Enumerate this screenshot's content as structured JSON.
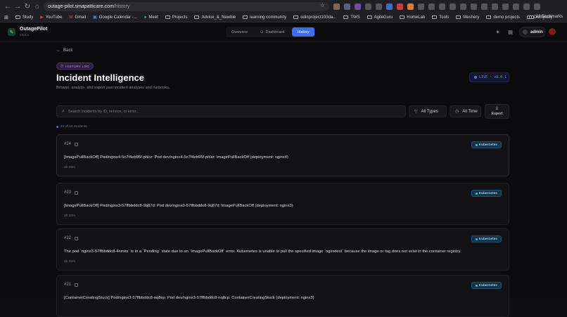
{
  "browser": {
    "url_host": "outage-pilot.smapatticare.com",
    "url_path": "/history",
    "bookmarks": [
      "Study",
      "YouTube",
      "Gmail",
      "Google Calendar -...",
      "Meet",
      "Projects",
      "Advice_&_Newbie",
      "learning community",
      "odinproject100da...",
      "TWS",
      "AgileGuru",
      "HomeLab",
      "Tools",
      "Meshery",
      "demo projects",
      "Demystify"
    ],
    "all_bookmarks": "All Bookmarks"
  },
  "app": {
    "brand": "OutagePilot",
    "version": "v.8.0.1",
    "tabs": [
      {
        "label": "Overview",
        "active": false
      },
      {
        "label": "Dashboard",
        "active": false
      },
      {
        "label": "History",
        "active": true
      }
    ],
    "user": "admin"
  },
  "page": {
    "back": "Back",
    "badge": "HISTORY LOG",
    "title": "Incident Intelligence",
    "subtitle": "Browse, analyze, and export past incident analyses and runbooks.",
    "live": "LIVE · v8.0.1",
    "search_placeholder": "Search incidents by ID, service, or error...",
    "filter_type": "All Types",
    "filter_time": "All Time",
    "export": "Export",
    "count": "24 of 24 incidents"
  },
  "incidents": [
    {
      "id": "#24",
      "tag": "Kubernetes",
      "text": "[ImagePullBackOff] Pod/nginx4-5c7f4eb95f-phlrz: Pod dev/nginx4-5c7f4eb95f-phlrz: ImagePullBackOff (deployment: nginx4)",
      "time": "1h 29m"
    },
    {
      "id": "#23",
      "tag": "Kubernetes",
      "text": "[ImagePullBackOff] Pod/nginx3-57ffbbddc8-9q87d: Pod dev/nginx3-57ffbbddc8-9q87d: ImagePullBackOff (deployment: nginx3)",
      "time": "1h 30m"
    },
    {
      "id": "#22",
      "tag": "Kubernetes",
      "text": "The pod `nginx3-57ffbbddc8-4nmks` is in a `Pending` state due to an `ImagePullBackOff` error. Kubernetes is unable to pull the specified image `nginxtest` because the image or tag does not exist in the container registry.",
      "time": "1h 32m"
    },
    {
      "id": "#21",
      "tag": "Kubernetes",
      "text": "[ContainerCreatingStuck] Pod/nginx3-57ffbbddc8-nq8cp: Pod dev/nginx3-57ffbbddc8-nq8cp: ContainerCreatingStuck (deployment: nginx3)",
      "time": ""
    }
  ]
}
